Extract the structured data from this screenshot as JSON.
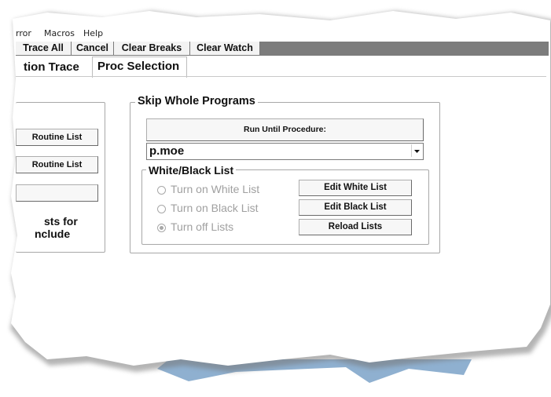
{
  "menu": {
    "items": [
      "rror",
      "Macros",
      "Help"
    ]
  },
  "toolbar": {
    "buttons": [
      "Trace All",
      "Cancel",
      "Clear Breaks",
      "Clear Watch"
    ]
  },
  "tabs": [
    {
      "label": "tion Trace",
      "active": false
    },
    {
      "label": "Proc Selection",
      "active": true
    }
  ],
  "left_panel": {
    "button1": "Routine List",
    "button2": "Routine List",
    "button3": "",
    "text_line1": "sts for",
    "text_line2": "nclude"
  },
  "skip_programs": {
    "title": "Skip Whole Programs",
    "run_until_label": "Run Until Procedure:",
    "procedure_value": "p.moe",
    "dropdown_arrow": "chevron-down-icon"
  },
  "white_black": {
    "title": "White/Black List",
    "radios": [
      {
        "label": "Turn on White List",
        "selected": false
      },
      {
        "label": "Turn on Black List",
        "selected": false
      },
      {
        "label": "Turn off Lists",
        "selected": true
      }
    ],
    "buttons": [
      "Edit White List",
      "Edit Black List",
      "Reload Lists"
    ]
  },
  "colors": {
    "toolbar_bg": "#7c7c7c",
    "desktop_blue": "#8fb0d0",
    "disabled_text": "#a0a0a0"
  }
}
